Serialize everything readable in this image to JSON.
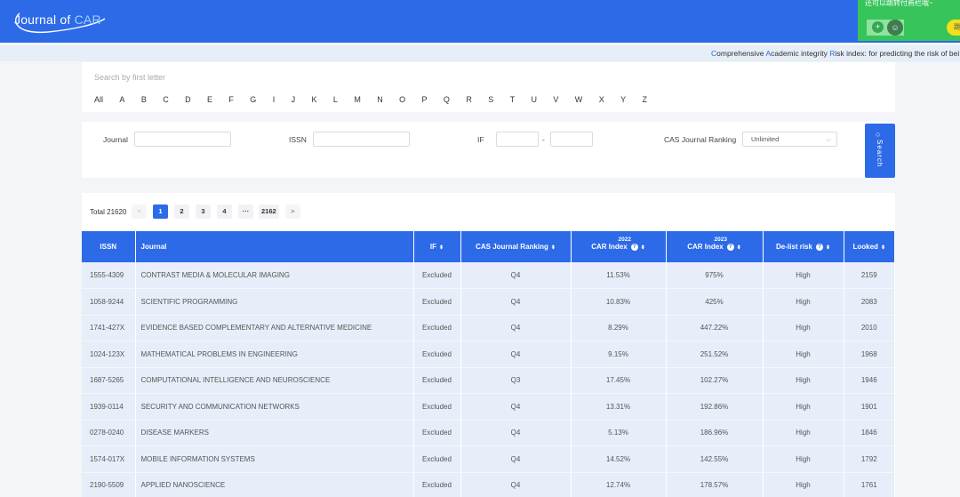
{
  "header": {
    "logo_prefix": "Journal of ",
    "logo_accent": "CAR",
    "promo_text": "还可以跳转付费栏哦~",
    "promo_button": "跳"
  },
  "ticker": {
    "c": "C",
    "omprehensive": "omprehensive ",
    "a": "A",
    "cademic": "cademic integrity ",
    "r": "R",
    "isk": "isk index",
    "tail": ": for predicting the risk of bei"
  },
  "letters": {
    "search_placeholder": "Search by first letter",
    "items": [
      "All",
      "A",
      "B",
      "C",
      "D",
      "E",
      "F",
      "G",
      "I",
      "J",
      "K",
      "L",
      "M",
      "N",
      "O",
      "P",
      "Q",
      "R",
      "S",
      "T",
      "U",
      "V",
      "W",
      "X",
      "Y",
      "Z"
    ]
  },
  "filters": {
    "journal_label": "Journal",
    "issn_label": "ISSN",
    "if_label": "IF",
    "if_sep": "-",
    "cas_label": "CAS Journal Ranking",
    "cas_value": "Unlimited",
    "search_label": "Search"
  },
  "pagination": {
    "total": "Total 21620",
    "prev": "<",
    "pages": [
      "1",
      "2",
      "3",
      "4",
      "···",
      "2162"
    ],
    "next": ">"
  },
  "table": {
    "headers": {
      "issn": "ISSN",
      "journal": "Journal",
      "if": "IF",
      "cas": "CAS Journal Ranking",
      "car2022": "CAR Index",
      "car2022_year": "2022",
      "car2023": "CAR Index",
      "car2023_year": "2023",
      "delist": "De-list risk",
      "looked": "Looked"
    },
    "rows": [
      {
        "issn": "1555-4309",
        "journal": "CONTRAST MEDIA & MOLECULAR IMAGING",
        "if": "Excluded",
        "cas": "Q4",
        "car2022": "11.53%",
        "car2023": "975%",
        "delist": "High",
        "looked": "2159"
      },
      {
        "issn": "1058-9244",
        "journal": "SCIENTIFIC PROGRAMMING",
        "if": "Excluded",
        "cas": "Q4",
        "car2022": "10.83%",
        "car2023": "425%",
        "delist": "High",
        "looked": "2083"
      },
      {
        "issn": "1741-427X",
        "journal": "EVIDENCE BASED COMPLEMENTARY AND ALTERNATIVE MEDICINE",
        "if": "Excluded",
        "cas": "Q4",
        "car2022": "8.29%",
        "car2023": "447.22%",
        "delist": "High",
        "looked": "2010"
      },
      {
        "issn": "1024-123X",
        "journal": "MATHEMATICAL PROBLEMS IN ENGINEERING",
        "if": "Excluded",
        "cas": "Q4",
        "car2022": "9.15%",
        "car2023": "251.52%",
        "delist": "High",
        "looked": "1968"
      },
      {
        "issn": "1687-5265",
        "journal": "COMPUTATIONAL INTELLIGENCE AND NEUROSCIENCE",
        "if": "Excluded",
        "cas": "Q3",
        "car2022": "17.45%",
        "car2023": "102.27%",
        "delist": "High",
        "looked": "1946"
      },
      {
        "issn": "1939-0114",
        "journal": "SECURITY AND COMMUNICATION NETWORKS",
        "if": "Excluded",
        "cas": "Q4",
        "car2022": "13.31%",
        "car2023": "192.86%",
        "delist": "High",
        "looked": "1901"
      },
      {
        "issn": "0278-0240",
        "journal": "DISEASE MARKERS",
        "if": "Excluded",
        "cas": "Q4",
        "car2022": "5.13%",
        "car2023": "186.96%",
        "delist": "High",
        "looked": "1846"
      },
      {
        "issn": "1574-017X",
        "journal": "MOBILE INFORMATION SYSTEMS",
        "if": "Excluded",
        "cas": "Q4",
        "car2022": "14.52%",
        "car2023": "142.55%",
        "delist": "High",
        "looked": "1792"
      },
      {
        "issn": "2190-5509",
        "journal": "APPLIED NANOSCIENCE",
        "if": "Excluded",
        "cas": "Q4",
        "car2022": "12.74%",
        "car2023": "178.57%",
        "delist": "High",
        "looked": "1761"
      }
    ]
  }
}
